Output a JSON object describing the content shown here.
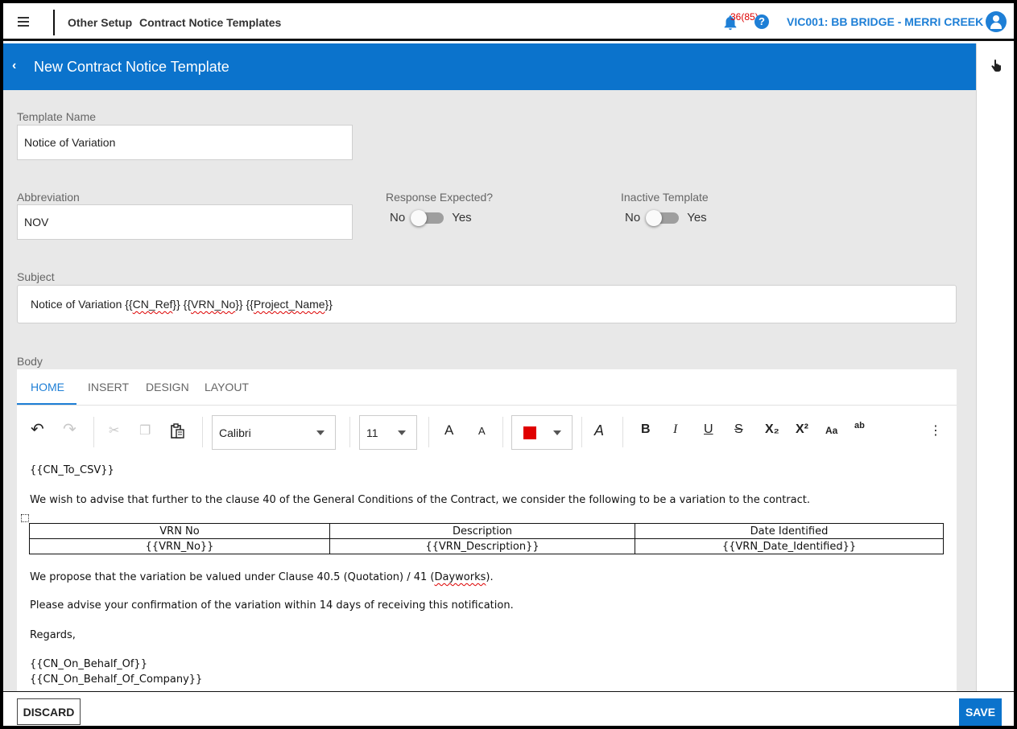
{
  "header": {
    "breadcrumb_parent": "Other Setup",
    "breadcrumb_current": "Contract Notice Templates",
    "notification_count": "36(85)",
    "help_glyph": "?",
    "project": "VIC001: BB BRIDGE - MERRI CREEK",
    "icons": [
      "hamburger-icon",
      "bell-icon",
      "help-icon",
      "account-icon"
    ]
  },
  "title_bar": {
    "title": "New Contract Notice Template",
    "back_glyph": "‹"
  },
  "form": {
    "template_name": {
      "label": "Template Name",
      "value": "Notice of Variation"
    },
    "abbreviation": {
      "label": "Abbreviation",
      "value": "NOV"
    },
    "response_expected": {
      "label": "Response Expected?",
      "off_label": "No",
      "on_label": "Yes",
      "checked": false
    },
    "inactive_template": {
      "label": "Inactive Template",
      "off_label": "No",
      "on_label": "Yes",
      "checked": false
    },
    "subject": {
      "label": "Subject",
      "text_prefix": "Notice of Variation {{",
      "token1": "CN_Ref",
      "mid1": "}} {{",
      "token2": "VRN_No",
      "mid2": "}} {{",
      "token3": "Project_Name",
      "suffix": "}}"
    },
    "body_label": "Body"
  },
  "editor": {
    "tabs": [
      "HOME",
      "INSERT",
      "DESIGN",
      "LAYOUT"
    ],
    "active_tab": "HOME",
    "font_name": "Calibri",
    "font_size": "11",
    "font_color": "#e00000",
    "toolbar_glyphs": {
      "undo": "↶",
      "redo": "↷",
      "cut": "✂",
      "copy": "❐",
      "paste": "📋",
      "grow": "A",
      "shrink": "A",
      "clear_format": "A",
      "bold": "B",
      "italic": "I",
      "underline": "U",
      "strike": "S",
      "subscript": "X₂",
      "superscript": "X²",
      "change_case": "Aa",
      "highlight": "ab",
      "more": "⋮"
    },
    "body": {
      "line1": "{{CN_To_CSV}}",
      "line2": "We wish to advise that further to the clause 40 of the General Conditions of the Contract, we consider the following to be a variation to the contract.",
      "table": {
        "headers": [
          "VRN No",
          "Description",
          "Date Identified"
        ],
        "row": [
          "{{VRN_No}}",
          "{{VRN_Description}}",
          "{{VRN_Date_Identified}}"
        ]
      },
      "line3_prefix": "We propose that the variation be valued under Clause 40.5 (Quotation) / 41 (",
      "line3_word": "Dayworks",
      "line3_suffix": ").",
      "line4": "Please advise your confirmation of the variation within 14 days of receiving this notification.",
      "line5": "Regards,",
      "line6": "{{CN_On_Behalf_Of}}",
      "line7": "{{CN_On_Behalf_Of_Company}}"
    }
  },
  "footer": {
    "discard_label": "DISCARD",
    "save_label": "SAVE"
  }
}
